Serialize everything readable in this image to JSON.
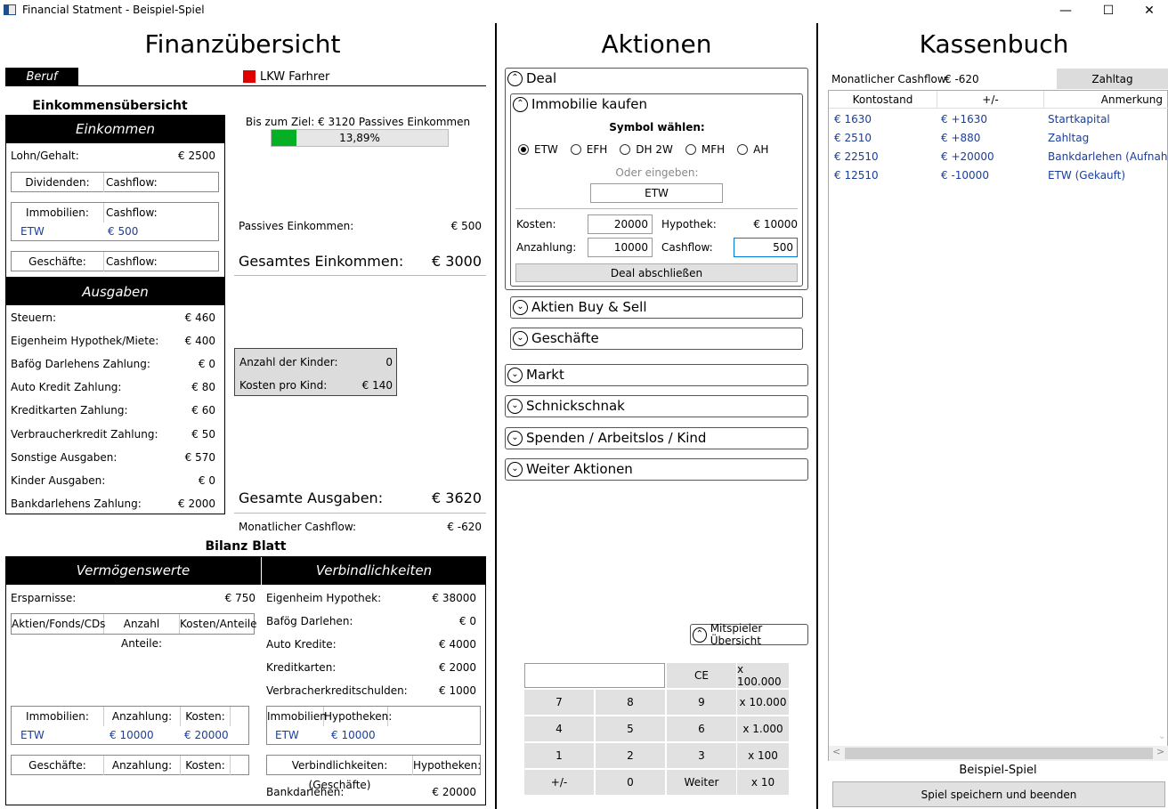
{
  "window": {
    "title": "Financial Statment - Beispiel-Spiel",
    "min": "—",
    "max": "☐",
    "close": "✕"
  },
  "finanz": {
    "title": "Finanzübersicht",
    "beruf_label": "Beruf",
    "beruf_value": "LKW Farhrer",
    "beruf_color": "#e00000",
    "einkommensuebersicht": "Einkommensübersicht",
    "einkommen_hdr": "Einkommen",
    "lohn_label": "Lohn/Gehalt:",
    "lohn_value": "€ 2500",
    "dividenden_hdr": [
      "Dividenden:",
      "Cashflow:"
    ],
    "immobilien_hdr": [
      "Immobilien:",
      "Cashflow:"
    ],
    "immobilien_rows": [
      [
        "ETW",
        "€ 500"
      ]
    ],
    "geschaefte_hdr": [
      "Geschäfte:",
      "Cashflow:"
    ],
    "goal_text": "Bis zum Ziel: € 3120 Passives Einkommen",
    "goal_percent_text": "13,89%",
    "goal_progress": 13.89,
    "goal_color": "#06b025",
    "passiv_label": "Passives Einkommen:",
    "passiv_value": "€ 500",
    "gesamt_ein_label": "Gesamtes Einkommen:",
    "gesamt_ein_value": "€ 3000",
    "ausgaben_hdr": "Ausgaben",
    "ausgaben": [
      {
        "label": "Steuern:",
        "value": "€ 460"
      },
      {
        "label": "Eigenheim Hypothek/Miete:",
        "value": "€ 400"
      },
      {
        "label": "Bafög Darlehens Zahlung:",
        "value": "€ 0"
      },
      {
        "label": "Auto Kredit Zahlung:",
        "value": "€ 80"
      },
      {
        "label": "Kreditkarten Zahlung:",
        "value": "€ 60"
      },
      {
        "label": "Verbraucherkredit Zahlung:",
        "value": "€ 50"
      },
      {
        "label": "Sonstige Ausgaben:",
        "value": "€ 570"
      },
      {
        "label": "Kinder Ausgaben:",
        "value": "€ 0"
      },
      {
        "label": "Bankdarlehens Zahlung:",
        "value": "€ 2000"
      }
    ],
    "kinder_label": "Anzahl der Kinder:",
    "kinder_value": "0",
    "kosten_kind_label": "Kosten pro Kind:",
    "kosten_kind_value": "€ 140",
    "gesamt_aus_label": "Gesamte Ausgaben:",
    "gesamt_aus_value": "€ 3620",
    "cashflow_label": "Monatlicher Cashflow:",
    "cashflow_value": "€ -620",
    "bilanz_title": "Bilanz Blatt",
    "vermoegen_hdr": "Vermögenswerte",
    "verbind_hdr": "Verbindlichkeiten",
    "ersparnisse_label": "Ersparnisse:",
    "ersparnisse_value": "€ 750",
    "aktien_hdr": [
      "Aktien/Fonds/CDs",
      "Anzahl Anteile:",
      "Kosten/Anteile"
    ],
    "immo_asset_hdr": [
      "Immobilien:",
      "Anzahlung:",
      "Kosten:"
    ],
    "immo_asset_rows": [
      [
        "ETW",
        "€ 10000",
        "€ 20000"
      ]
    ],
    "gesch_asset_hdr": [
      "Geschäfte:",
      "Anzahlung:",
      "Kosten:"
    ],
    "liab": [
      {
        "label": "Eigenheim Hypothek:",
        "value": "€ 38000"
      },
      {
        "label": "Bafög Darlehen:",
        "value": "€ 0"
      },
      {
        "label": "Auto Kredite:",
        "value": "€ 4000"
      },
      {
        "label": "Kreditkarten:",
        "value": "€ 2000"
      },
      {
        "label": "Verbracherkreditschulden:",
        "value": "€ 1000"
      }
    ],
    "immo_liab_hdr": [
      "Immobilien",
      "Hypotheken:"
    ],
    "immo_liab_rows": [
      [
        "ETW",
        "€ 10000"
      ]
    ],
    "gesch_liab_hdr": [
      "Verbindlichkeiten: (Geschäfte)",
      "Hypotheken:"
    ],
    "bank_label": "Bankdarlehen:",
    "bank_value": "€ 20000"
  },
  "aktionen": {
    "title": "Aktionen",
    "deal": "Deal",
    "immobilie_kaufen": "Immobilie kaufen",
    "symbol_waehlen": "Symbol wählen:",
    "radios": [
      "ETW",
      "EFH",
      "DH 2W",
      "MFH",
      "AH"
    ],
    "selected_radio": "ETW",
    "oder_eingeben": "Oder eingeben:",
    "symbol_input": "ETW",
    "kosten_label": "Kosten:",
    "kosten_value": "20000",
    "hypothek_label": "Hypothek:",
    "hypothek_value": "€ 10000",
    "anzahlung_label": "Anzahlung:",
    "anzahlung_value": "10000",
    "cashflow_label": "Cashflow:",
    "cashflow_value": "500",
    "deal_abschliessen": "Deal abschließen",
    "aktien": "Aktien Buy & Sell",
    "geschaefte": "Geschäfte",
    "markt": "Markt",
    "schnickschnak": "Schnickschnak",
    "spenden": "Spenden / Arbeitslos / Kind",
    "weiter_aktionen": "Weiter Aktionen",
    "mitspieler": "Mitspieler Übersicht",
    "calc_display": "",
    "keys": {
      "ce": "CE",
      "x100000": "x 100.000",
      "k7": "7",
      "k8": "8",
      "k9": "9",
      "x10000": "x 10.000",
      "k4": "4",
      "k5": "5",
      "k6": "6",
      "x1000": "x 1.000",
      "k1": "1",
      "k2": "2",
      "k3": "3",
      "x100": "x 100",
      "pm": "+/-",
      "k0": "0",
      "weiter": "Weiter",
      "x10": "x 10"
    }
  },
  "kassenbuch": {
    "title": "Kassenbuch",
    "cashflow_label": "Monatlicher Cashflow:",
    "cashflow_value": "€ -620",
    "zahltag": "Zahltag",
    "headers": [
      "Kontostand",
      "+/-",
      "Anmerkung"
    ],
    "rows": [
      [
        "€ 1630",
        "€ +1630",
        "Startkapital"
      ],
      [
        "€ 2510",
        "€ +880",
        "Zahltag"
      ],
      [
        "€ 22510",
        "€ +20000",
        "Bankdarlehen (Aufnah"
      ],
      [
        "€ 12510",
        "€ -10000",
        "ETW (Gekauft)"
      ]
    ],
    "game_name": "Beispiel-Spiel",
    "save_exit": "Spiel speichern und beenden"
  }
}
